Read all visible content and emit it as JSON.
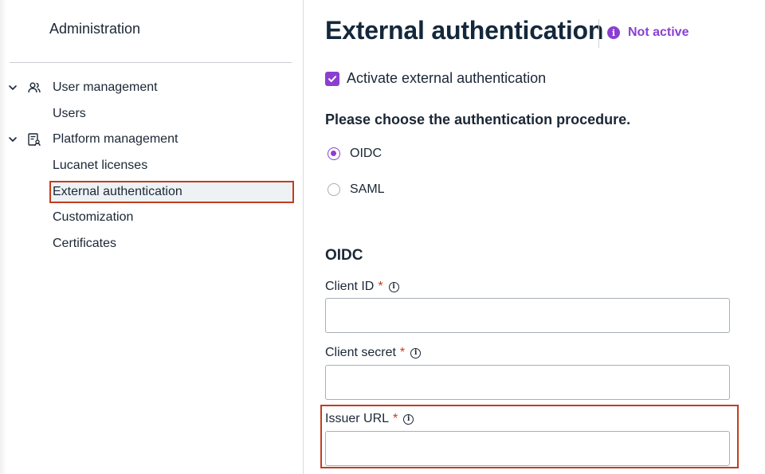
{
  "sidebar": {
    "title": "Administration",
    "groups": [
      {
        "label": "User management",
        "icon": "users-icon",
        "items": [
          "Users"
        ]
      },
      {
        "label": "Platform management",
        "icon": "platform-settings-icon",
        "items": [
          "Lucanet licenses",
          "External authentication",
          "Customization",
          "Certificates"
        ]
      }
    ],
    "active_item": "External authentication"
  },
  "main": {
    "title": "External authentication",
    "status": {
      "text": "Not active",
      "icon": "info-icon",
      "color": "#8b3fd1"
    },
    "activate": {
      "label": "Activate external authentication",
      "checked": true
    },
    "procedure": {
      "question": "Please choose the authentication procedure.",
      "options": [
        "OIDC",
        "SAML"
      ],
      "selected": "OIDC"
    },
    "oidc": {
      "section_title": "OIDC",
      "fields": [
        {
          "label": "Client ID",
          "required_mark": "*",
          "value": ""
        },
        {
          "label": "Client secret",
          "required_mark": "*",
          "value": ""
        },
        {
          "label": "Issuer URL",
          "required_mark": "*",
          "value": ""
        }
      ]
    }
  },
  "colors": {
    "accent": "#8b3fd1",
    "highlight": "#c23d1e",
    "required": "#c9381a"
  }
}
